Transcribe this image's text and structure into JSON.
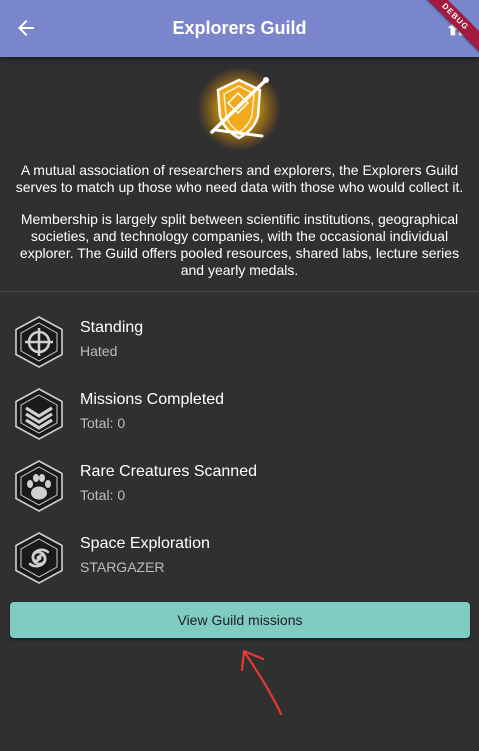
{
  "appbar": {
    "title": "Explorers Guild",
    "back_icon": "arrow-back-icon",
    "action_icon": "home-icon",
    "color": "#7986cb"
  },
  "debug_banner": {
    "label": "DEBUG",
    "color": "#a3193f"
  },
  "guild": {
    "emblem_icon": "explorers-guild-emblem-icon",
    "description_1": "A mutual association of researchers and explorers, the Explorers Guild serves to match up those who need data with those who would collect it.",
    "description_2": "Membership is largely split between scientific institutions, geographical societies, and technology companies, with the occasional individual explorer. The Guild offers pooled resources, shared labs, lecture series and yearly medals."
  },
  "stats": [
    {
      "icon": "standing-badge-icon",
      "title": "Standing",
      "subtitle": "Hated"
    },
    {
      "icon": "missions-chevron-badge-icon",
      "title": "Missions Completed",
      "subtitle": "Total: 0"
    },
    {
      "icon": "paw-badge-icon",
      "title": "Rare Creatures Scanned",
      "subtitle": "Total: 0"
    },
    {
      "icon": "spiral-galaxy-badge-icon",
      "title": "Space Exploration",
      "subtitle": "STARGAZER"
    }
  ],
  "actions": {
    "view_missions_label": "View Guild missions",
    "button_color": "#80cbc4"
  },
  "annotation": {
    "icon": "red-arrow-annotation-icon",
    "color": "#e53935"
  }
}
